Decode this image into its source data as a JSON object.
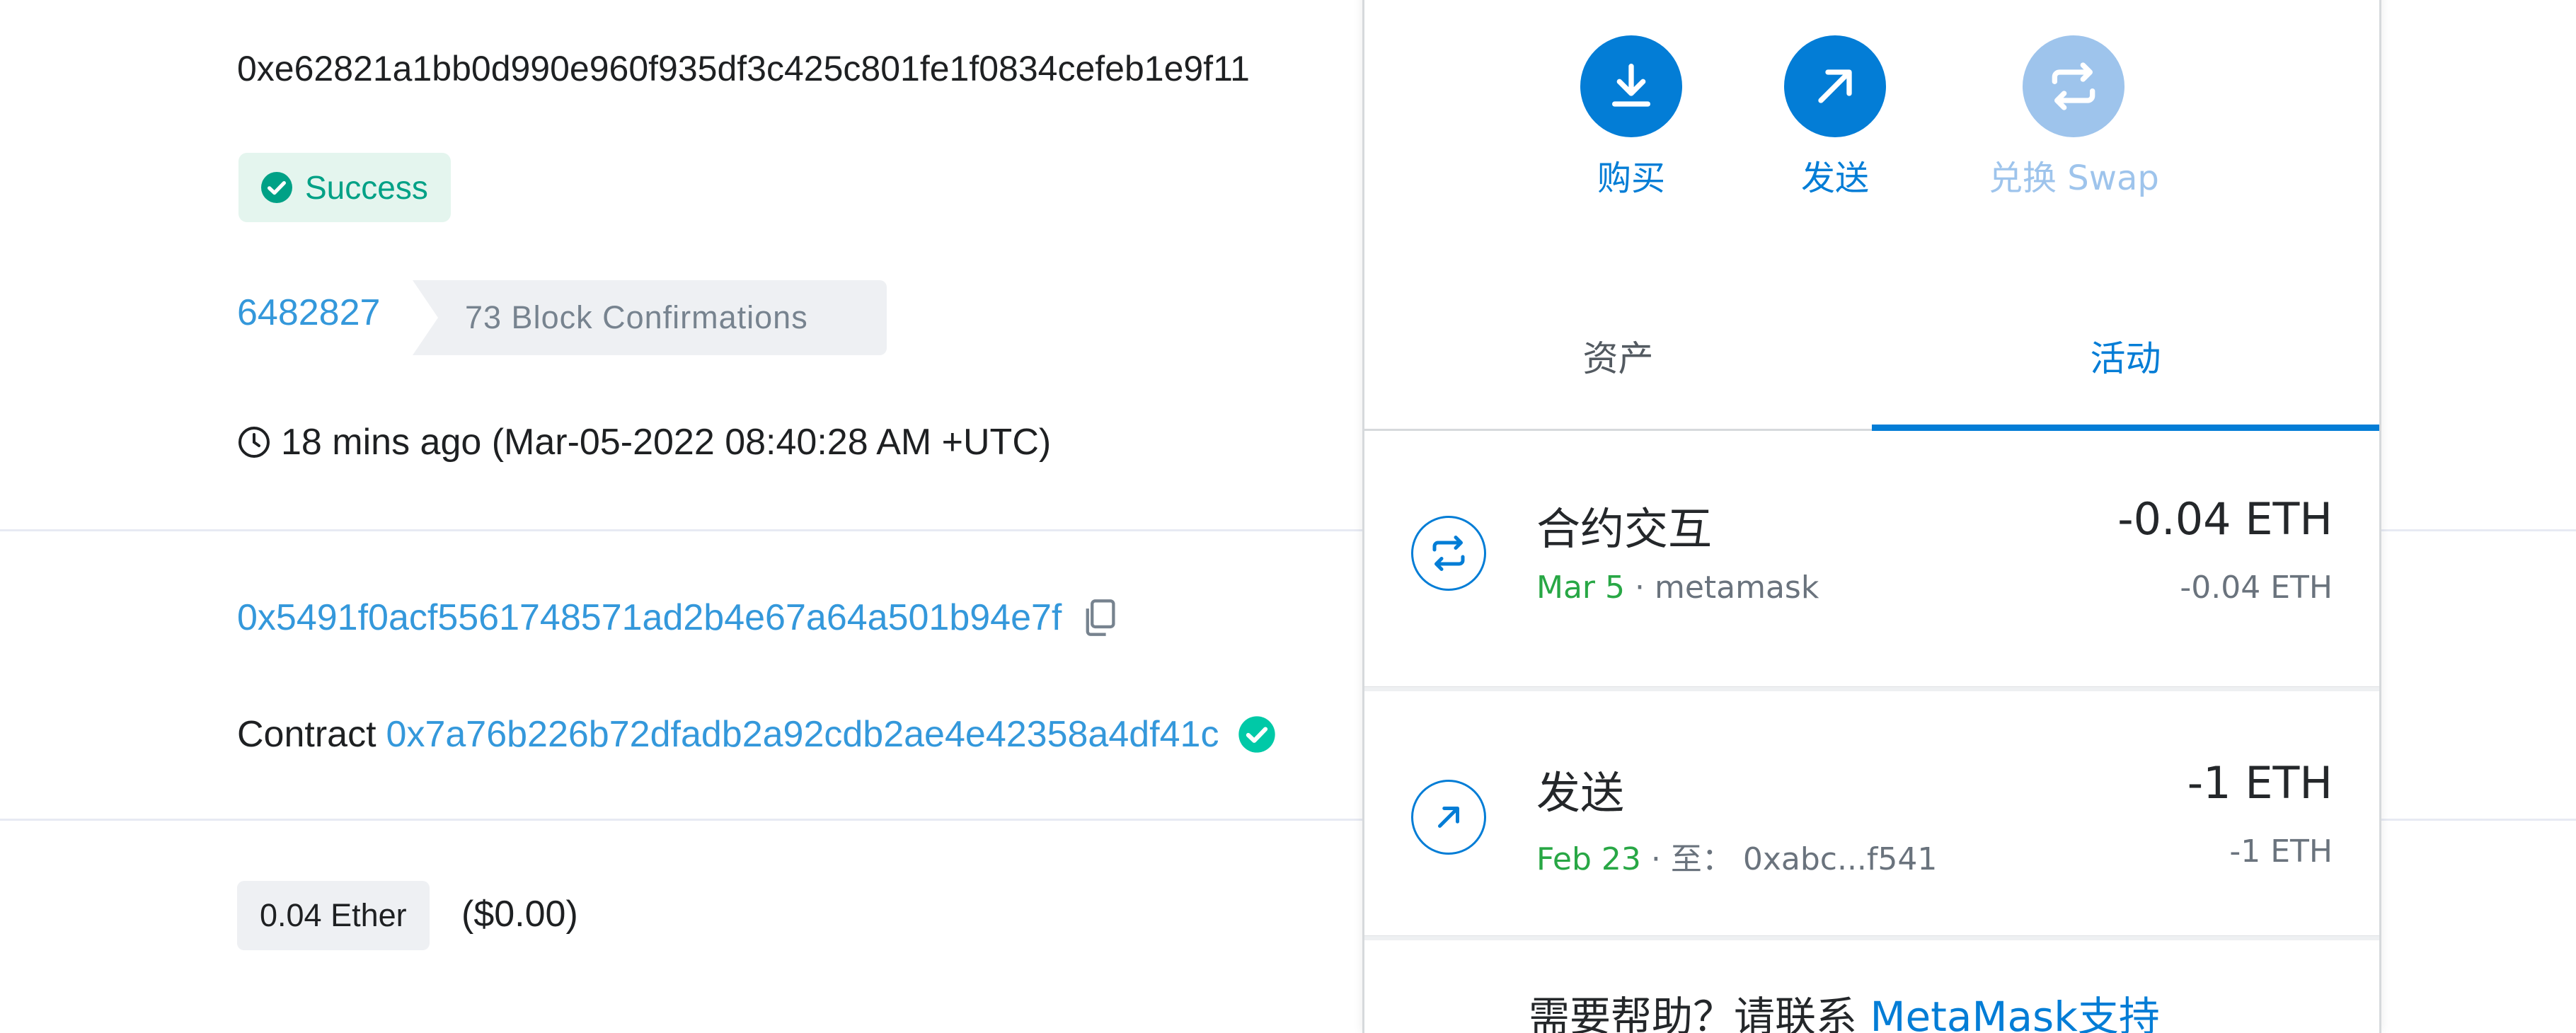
{
  "etherscan": {
    "tx_hash": "0xe62821a1bb0d990e960f935df3c425c801fe1f0834cefeb1e9f11",
    "status": "Success",
    "block_number": "6482827",
    "block_confirmations": "73 Block Confirmations",
    "timestamp": "18 mins ago (Mar-05-2022 08:40:28 AM +UTC)",
    "from_address": "0x5491f0acf5561748571ad2b4e67a64a501b94e7f",
    "to_prefix": "Contract",
    "to_address": "0x7a76b226b72dfadb2a92cdb2ae4e42358a4df41c",
    "value": "0.04 Ether",
    "value_usd": "($0.00)"
  },
  "metamask": {
    "actions": {
      "buy": "购买",
      "send": "发送",
      "swap": "兑换 Swap"
    },
    "tabs": {
      "assets": "资产",
      "activity": "活动"
    },
    "transactions": [
      {
        "title": "合约交互",
        "date": "Mar 5",
        "detail": " · metamask",
        "amount": "-0.04 ETH",
        "amount_secondary": "-0.04 ETH",
        "icon": "swap-arrows-icon"
      },
      {
        "title": "发送",
        "date": "Feb 23",
        "detail": " · 至：  0xabc...f541",
        "amount": "-1 ETH",
        "amount_secondary": "-1 ETH",
        "icon": "send-arrow-icon"
      }
    ],
    "help": {
      "prefix": "需要帮助？请联系 ",
      "link": "MetaMask支持"
    }
  },
  "colors": {
    "metamask_blue": "#037dd6",
    "etherscan_link": "#3498db",
    "success_green": "#00a186",
    "date_green": "#28a745"
  }
}
